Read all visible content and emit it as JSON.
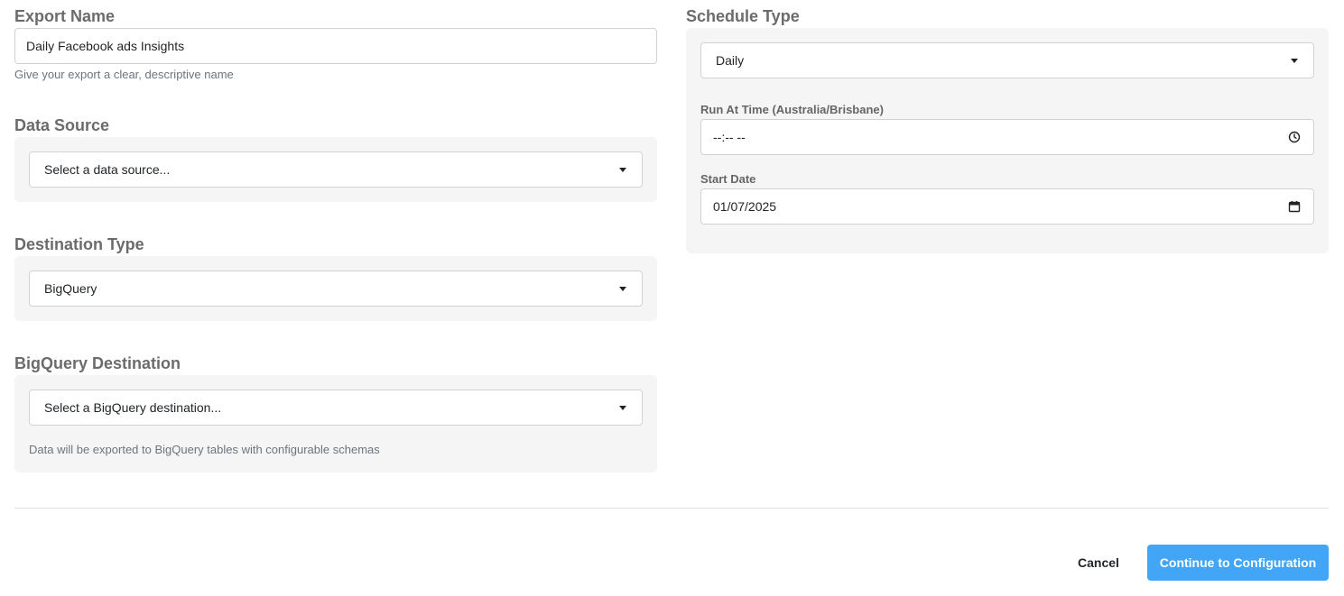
{
  "export_name": {
    "title": "Export Name",
    "value": "Daily Facebook ads Insights",
    "help": "Give your export a clear, descriptive name"
  },
  "data_source": {
    "title": "Data Source",
    "selected": "Select a data source..."
  },
  "destination_type": {
    "title": "Destination Type",
    "selected": "BigQuery"
  },
  "bigquery_destination": {
    "title": "BigQuery Destination",
    "selected": "Select a BigQuery destination...",
    "help": "Data will be exported to BigQuery tables with configurable schemas"
  },
  "schedule": {
    "title": "Schedule Type",
    "selected": "Daily",
    "run_time_label": "Run At Time (Australia/Brisbane)",
    "run_time_value": "--:-- --",
    "start_date_label": "Start Date",
    "start_date_value": "01/07/2025"
  },
  "actions": {
    "cancel": "Cancel",
    "continue": "Continue to Configuration"
  },
  "colors": {
    "primary": "#42a5f5",
    "panel": "#f5f5f5",
    "title": "#6b6b6b"
  }
}
